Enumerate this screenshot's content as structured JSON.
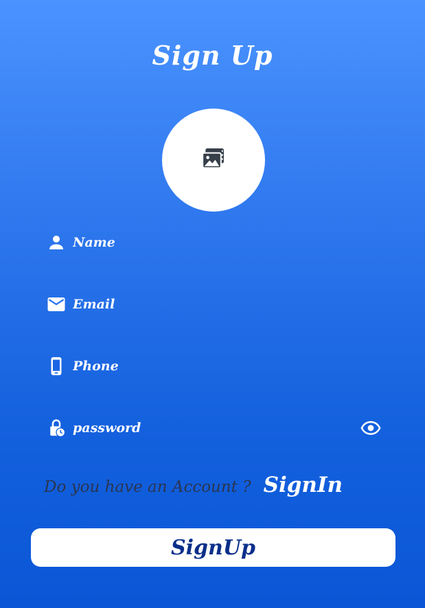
{
  "header": {
    "title": "Sign Up"
  },
  "avatar": {
    "icon": "photo-library-icon"
  },
  "fields": {
    "name": {
      "placeholder": "Name",
      "icon": "person-icon"
    },
    "email": {
      "placeholder": "Email",
      "icon": "mail-icon"
    },
    "phone": {
      "placeholder": "Phone",
      "icon": "smartphone-icon"
    },
    "password": {
      "placeholder": "password",
      "icon": "lock-clock-icon",
      "toggle_icon": "eye-icon"
    }
  },
  "account": {
    "question": "Do you have an Account ?",
    "signin_label": "SignIn"
  },
  "submit": {
    "label": "SignUp"
  },
  "colors": {
    "accent": "#0a56d6",
    "button_text": "#0b2f8a",
    "question_text": "#2a3550"
  }
}
